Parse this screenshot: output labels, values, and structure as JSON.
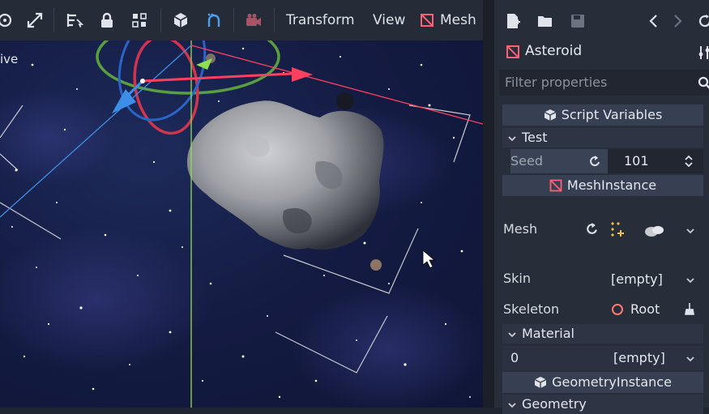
{
  "toolbar": {
    "menus": [
      "Transform",
      "View",
      "Mesh"
    ]
  },
  "viewport": {
    "label": "ive"
  },
  "inspector": {
    "node_name": "Asteroid",
    "filter_placeholder": "Filter properties",
    "sections": {
      "script_variables": "Script Variables",
      "test": "Test",
      "mesh_instance": "MeshInstance",
      "material": "Material",
      "geometry_instance": "GeometryInstance",
      "geometry": "Geometry"
    },
    "props": {
      "seed_label": "Seed",
      "seed_value": "101",
      "mesh_label": "Mesh",
      "skin_label": "Skin",
      "skin_value": "[empty]",
      "skeleton_label": "Skeleton",
      "skeleton_value": "Root",
      "material_index": "0",
      "material_value": "[empty]"
    }
  },
  "colors": {
    "accent_red": "#ff5f73",
    "axis_blue": "#3d8ee8",
    "axis_green": "#8fe051",
    "axis_red": "#ff3f5e"
  }
}
